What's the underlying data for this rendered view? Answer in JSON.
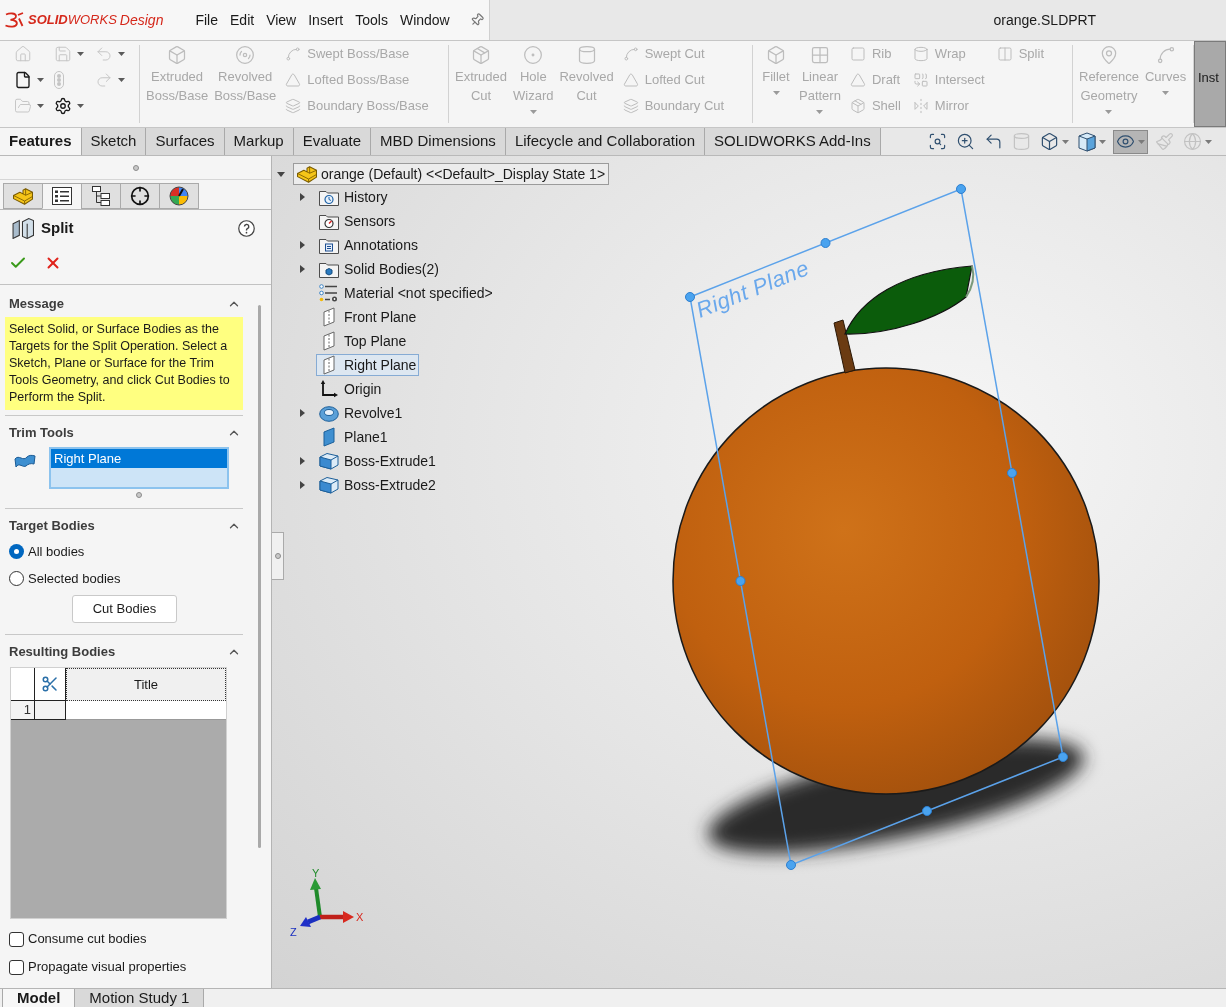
{
  "title_bar": {
    "logo": {
      "brand": "**SOLID**WORKS",
      "product": "Design"
    },
    "menu": [
      "File",
      "Edit",
      "View",
      "Insert",
      "Tools",
      "Window"
    ],
    "document_title": "orange.SLDPRT"
  },
  "quick_access": [
    {
      "disabled": true,
      "dropdown": false
    },
    {
      "disabled": true,
      "dropdown": true
    },
    {
      "disabled": true,
      "dropdown": true
    },
    {
      "disabled": false,
      "dropdown": true
    },
    {
      "disabled": true,
      "dropdown": false
    },
    {
      "disabled": true,
      "dropdown": true
    },
    {
      "disabled": true,
      "dropdown": true
    },
    {
      "disabled": false,
      "dropdown": true
    }
  ],
  "ribbon": [
    {
      "commands": [
        {
          "label": "Extruded Boss/Base",
          "kind": "large",
          "disabled": true,
          "dropdown": false
        },
        {
          "label": "Revolved Boss/Base",
          "kind": "large",
          "disabled": true,
          "dropdown": false
        },
        {
          "label": "Swept Boss/Base",
          "kind": "small",
          "disabled": true
        },
        {
          "label": "Lofted Boss/Base",
          "kind": "small",
          "disabled": true
        },
        {
          "label": "Boundary Boss/Base",
          "kind": "small",
          "disabled": true
        }
      ]
    },
    {
      "commands": [
        {
          "label": "Extruded Cut",
          "kind": "large",
          "disabled": true,
          "dropdown": false
        },
        {
          "label": "Hole Wizard",
          "kind": "large",
          "disabled": true,
          "dropdown": true
        },
        {
          "label": "Revolved Cut",
          "kind": "large",
          "disabled": true,
          "dropdown": false
        },
        {
          "label": "Swept Cut",
          "kind": "small",
          "disabled": true
        },
        {
          "label": "Lofted Cut",
          "kind": "small",
          "disabled": true
        },
        {
          "label": "Boundary Cut",
          "kind": "small",
          "disabled": true
        }
      ]
    },
    {
      "commands": [
        {
          "label": "Fillet",
          "kind": "large",
          "disabled": true,
          "dropdown": true
        },
        {
          "label": "Linear Pattern",
          "kind": "large",
          "disabled": true,
          "dropdown": true
        },
        {
          "label": "Rib",
          "kind": "small",
          "disabled": true
        },
        {
          "label": "Draft",
          "kind": "small",
          "disabled": true
        },
        {
          "label": "Shell",
          "kind": "small",
          "disabled": true
        },
        {
          "label": "Wrap",
          "kind": "small",
          "disabled": true
        },
        {
          "label": "Intersect",
          "kind": "small",
          "disabled": true
        },
        {
          "label": "Mirror",
          "kind": "small",
          "disabled": true
        },
        {
          "label": "Split",
          "kind": "small",
          "disabled": true
        }
      ]
    },
    {
      "commands": [
        {
          "label": "Reference Geometry",
          "kind": "large",
          "disabled": true,
          "dropdown": true
        },
        {
          "label": "Curves",
          "kind": "large",
          "disabled": true,
          "dropdown": true
        }
      ]
    },
    {
      "commands": [
        {
          "label": "Inst",
          "kind": "large",
          "disabled": false,
          "dropdown": false,
          "pressed": true
        }
      ]
    }
  ],
  "command_tabs": [
    {
      "label": "Features",
      "selected": true
    },
    {
      "label": "Sketch",
      "selected": false
    },
    {
      "label": "Surfaces",
      "selected": false
    },
    {
      "label": "Markup",
      "selected": false
    },
    {
      "label": "Evaluate",
      "selected": false
    },
    {
      "label": "MBD Dimensions",
      "selected": false
    },
    {
      "label": "Lifecycle and Collaboration",
      "selected": false
    },
    {
      "label": "SOLIDWORKS Add-Ins",
      "selected": false
    }
  ],
  "view_tools": [
    {
      "disabled": false,
      "dropdown": false,
      "pressed": false
    },
    {
      "disabled": false,
      "dropdown": false,
      "pressed": false
    },
    {
      "disabled": false,
      "dropdown": false,
      "pressed": false
    },
    {
      "disabled": true,
      "dropdown": false,
      "pressed": false
    },
    {
      "disabled": false,
      "dropdown": true,
      "pressed": false
    },
    {
      "disabled": false,
      "dropdown": true,
      "pressed": false
    },
    {
      "disabled": false,
      "dropdown": true,
      "pressed": true
    },
    {
      "disabled": true,
      "dropdown": false,
      "pressed": false
    },
    {
      "disabled": true,
      "dropdown": true,
      "pressed": false
    }
  ],
  "panel_tabs": [
    {
      "selected": false
    },
    {
      "selected": true
    },
    {
      "selected": false
    },
    {
      "selected": false
    },
    {
      "selected": false
    }
  ],
  "property_manager": {
    "title": "Split",
    "message": {
      "title": "Message",
      "expanded": true,
      "text": "Select Solid, or Surface Bodies as the Targets for the Split Operation. Select a Sketch, Plane or Surface for the Trim Tools Geometry, and click Cut Bodies to Perform the Split."
    },
    "trim_tools": {
      "title": "Trim Tools",
      "expanded": true,
      "items": [
        {
          "label": "Right Plane",
          "selected": true
        }
      ]
    },
    "target_bodies": {
      "title": "Target Bodies",
      "expanded": true,
      "options": [
        {
          "label": "All bodies",
          "selected": true
        },
        {
          "label": "Selected bodies",
          "selected": false
        }
      ],
      "button": "Cut Bodies"
    },
    "resulting_bodies": {
      "title": "Resulting Bodies",
      "expanded": true,
      "columns": [
        "Title"
      ],
      "rows": [
        {
          "number": "1"
        }
      ]
    },
    "checkboxes": [
      {
        "label": "Consume cut bodies",
        "checked": false
      },
      {
        "label": "Propagate visual properties",
        "checked": false
      }
    ]
  },
  "feature_tree": {
    "root": {
      "label": "orange (Default) <<Default>_Display State 1>",
      "expanded": true
    },
    "items": [
      {
        "label": "History",
        "expanded": false,
        "selected": false
      },
      {
        "label": "Sensors",
        "selected": false
      },
      {
        "label": "Annotations",
        "expanded": false,
        "selected": false
      },
      {
        "label": "Solid Bodies(2)",
        "expanded": false,
        "selected": false
      },
      {
        "label": "Material <not specified>",
        "selected": false
      },
      {
        "label": "Front Plane",
        "selected": false
      },
      {
        "label": "Top Plane",
        "selected": false
      },
      {
        "label": "Right Plane",
        "selected": true
      },
      {
        "label": "Origin",
        "selected": false
      },
      {
        "label": "Revolve1",
        "expanded": false,
        "selected": false
      },
      {
        "label": "Plane1",
        "selected": false
      },
      {
        "label": "Boss-Extrude1",
        "expanded": false,
        "selected": false
      },
      {
        "label": "Boss-Extrude2",
        "expanded": false,
        "selected": false
      }
    ]
  },
  "viewport": {
    "plane_label": "Right Plane",
    "triad": {
      "x": "X",
      "y": "Y",
      "z": "Z"
    }
  },
  "bottom_tabs": [
    {
      "label": "Model",
      "selected": true
    },
    {
      "label": "Motion Study 1",
      "selected": false
    }
  ]
}
